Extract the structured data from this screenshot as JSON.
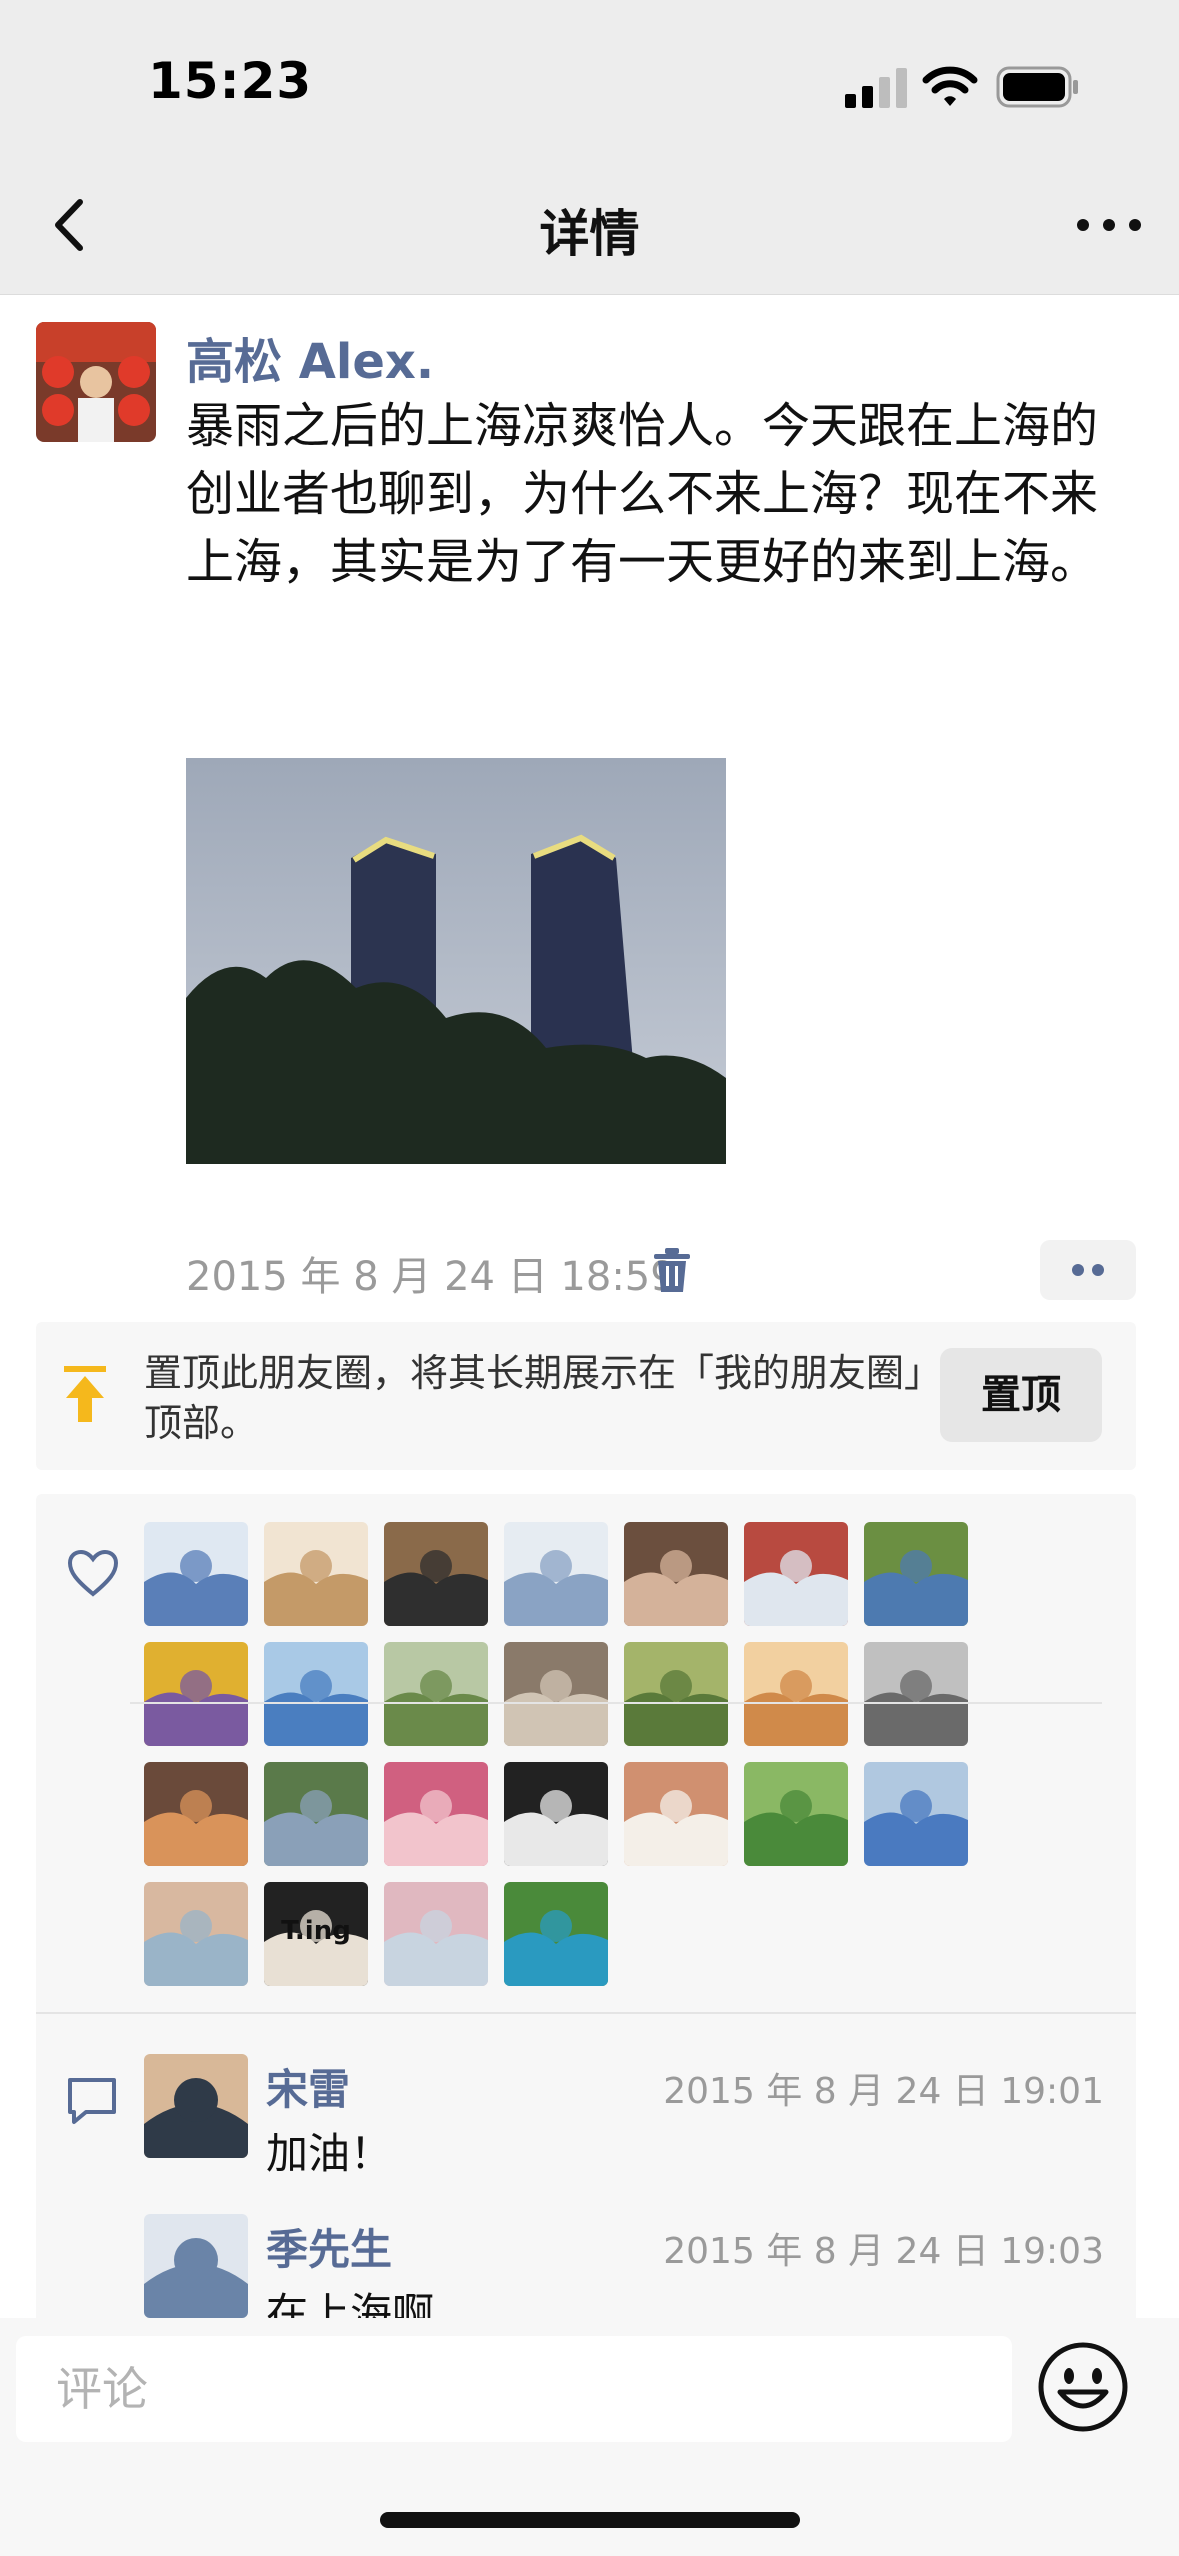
{
  "status_bar": {
    "time": "15:23"
  },
  "nav": {
    "title": "详情",
    "back_icon": "chevron-left-icon",
    "more_icon": "more-dots-icon"
  },
  "post": {
    "author": "高松 Alex.",
    "text": "暴雨之后的上海凉爽怡人。今天跟在上海的创业者也聊到，为什么不来上海？现在不来上海，其实是为了有一天更好的来到上海。",
    "time": "2015 年 8 月 24 日  18:59"
  },
  "pin": {
    "text": "置顶此朋友圈，将其长期展示在「我的朋友圈」顶部。",
    "button": "置顶",
    "icon_color": "#f5b81c"
  },
  "likes": {
    "icon": "heart-icon",
    "avatars": [
      {
        "c1": "#5a7fb8",
        "c2": "#dfe8f2"
      },
      {
        "c1": "#c49a68",
        "c2": "#f1e4d2"
      },
      {
        "c1": "#2f2f2f",
        "c2": "#8a6a4a"
      },
      {
        "c1": "#8aa3c4",
        "c2": "#e6ecf2"
      },
      {
        "c1": "#d4b29a",
        "c2": "#6b4f3e"
      },
      {
        "c1": "#dfe6ee",
        "c2": "#b84a40"
      },
      {
        "c1": "#4d7ab0",
        "c2": "#6b8f42"
      },
      {
        "c1": "#7a5aa0",
        "c2": "#e0b030"
      },
      {
        "c1": "#4a7ec0",
        "c2": "#a9c9e6"
      },
      {
        "c1": "#6a8a4a",
        "c2": "#b8c8a4"
      },
      {
        "c1": "#d0c4b4",
        "c2": "#8a7a6a"
      },
      {
        "c1": "#5a7a3a",
        "c2": "#a4b46a"
      },
      {
        "c1": "#d08a4a",
        "c2": "#f2d0a0"
      },
      {
        "c1": "#6a6a6a",
        "c2": "#c0c0c0"
      },
      {
        "c1": "#d9935a",
        "c2": "#6a4a3a"
      },
      {
        "c1": "#8aa0b8",
        "c2": "#5a7a4a"
      },
      {
        "c1": "#f2c4cc",
        "c2": "#d06080"
      },
      {
        "c1": "#e8e8e8",
        "c2": "#222222"
      },
      {
        "c1": "#f4efe8",
        "c2": "#d09070"
      },
      {
        "c1": "#4a8a3a",
        "c2": "#8ab864"
      },
      {
        "c1": "#4a7ac0",
        "c2": "#b0c8e0"
      },
      {
        "c1": "#9ab4c8",
        "c2": "#d8b8a0"
      },
      {
        "c1": "#e8e0d4",
        "c2": "#222222"
      },
      {
        "c1": "#c8d4e0",
        "c2": "#e0b8c0"
      },
      {
        "c1": "#2a9ac0",
        "c2": "#4a8a3a"
      }
    ],
    "t_label": "T.ing"
  },
  "comments": {
    "icon": "comment-bubble-icon",
    "items": [
      {
        "name": "宋雷",
        "time": "2015 年 8 月 24 日  19:01",
        "text": "加油！",
        "c1": "#2f3a48",
        "c2": "#d8b898"
      },
      {
        "name": "季先生",
        "time": "2015 年 8 月 24 日  19:03",
        "text": "在上海啊",
        "c1": "#6a84a8",
        "c2": "#e0e6ee"
      }
    ]
  },
  "bottom": {
    "placeholder": "评论",
    "emoji_icon": "smiley-face-icon"
  }
}
